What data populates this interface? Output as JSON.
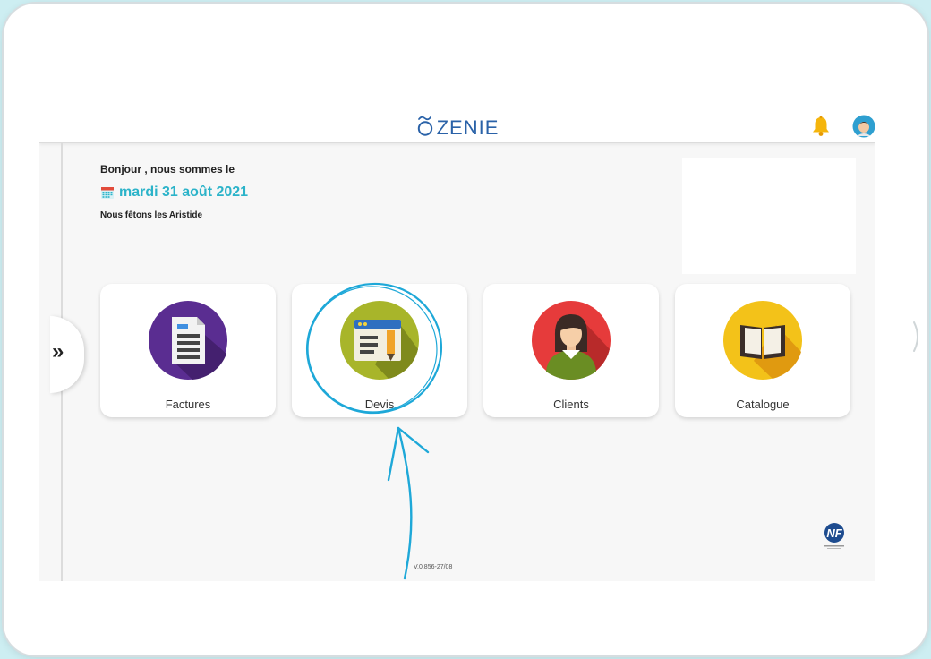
{
  "app": {
    "name": "ZENIE"
  },
  "header": {
    "notification_icon": "bell-icon",
    "profile_icon": "user-avatar-icon"
  },
  "greeting": {
    "line1": "Bonjour , nous sommes le",
    "date": "mardi 31 août 2021",
    "feast": "Nous fêtons les Aristide",
    "date_icon": "calendar-icon"
  },
  "tiles": [
    {
      "label": "Factures",
      "icon": "invoice-document-icon"
    },
    {
      "label": "Devis",
      "icon": "quote-edit-icon"
    },
    {
      "label": "Clients",
      "icon": "client-person-icon"
    },
    {
      "label": "Catalogue",
      "icon": "open-book-icon"
    }
  ],
  "sidebar": {
    "toggle_label": "»"
  },
  "footer": {
    "version": "V.0.856-27/08",
    "certification_icon": "nf-certification-logo"
  },
  "colors": {
    "accent": "#2bb3c9",
    "brand": "#2a62a8",
    "annotation": "#1ea8d8"
  }
}
